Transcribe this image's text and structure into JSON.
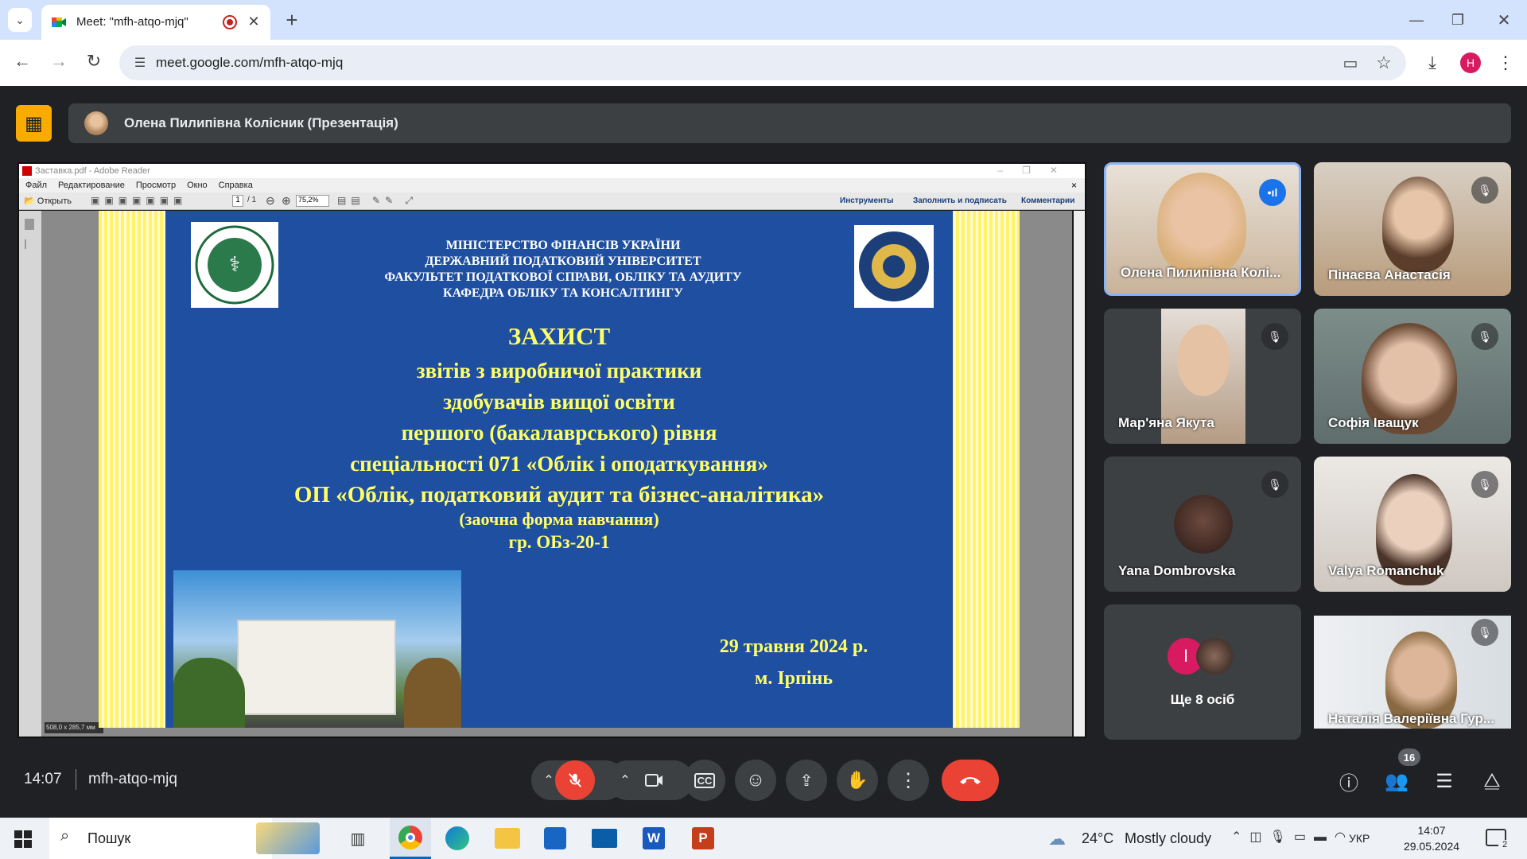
{
  "browser": {
    "tab_title": "Meet: \"mfh-atqo-mjq\"",
    "url": "meet.google.com/mfh-atqo-mjq",
    "profile_initial": "H",
    "window_controls": [
      "minimize",
      "restore",
      "close"
    ]
  },
  "presenter_bar": {
    "label": "Олена Пилипівна Колісник (Презентація)"
  },
  "reader": {
    "title": "Заставка.pdf - Adobe Reader",
    "menu": [
      "Файл",
      "Редактирование",
      "Просмотр",
      "Окно",
      "Справка"
    ],
    "open_label": "Открыть",
    "page_current": "1",
    "page_total": "/ 1",
    "zoom": "75,2%",
    "right_buttons": [
      "Инструменты",
      "Заполнить и подписать",
      "Комментарии"
    ],
    "size_label": "508,0 x 285,7 мм"
  },
  "slide": {
    "header_lines": [
      "МІНІСТЕРСТВО ФІНАНСІВ УКРАЇНИ",
      "ДЕРЖАВНИЙ ПОДАТКОВИЙ УНІВЕРСИТЕТ",
      "ФАКУЛЬТЕТ ПОДАТКОВОЇ СПРАВИ, ОБЛІКУ ТА АУДИТУ",
      "КАФЕДРА ОБЛІКУ ТА КОНСАЛТИНГУ"
    ],
    "title": "ЗАХИСТ",
    "body_lines": [
      "звітів з виробничої практики",
      "здобувачів вищої освіти",
      "першого (бакалаврського) рівня",
      "спеціальності 071 «Облік і оподаткування»",
      "ОП «Облік, податковий аудит та бізнес-аналітика»"
    ],
    "form_line": "(заочна форма навчання)",
    "group_line": "гр. ОБз-20-1",
    "date_line": "29 травня 2024 р.",
    "city_line": "м. Ірпінь",
    "colors": {
      "background": "#1e4fa3",
      "text": "#ffff66",
      "stripes": "#fff36b"
    }
  },
  "participants": [
    {
      "name": "Олена Пилипівна Колі...",
      "muted": false,
      "speaking": true
    },
    {
      "name": "Пінаєва Анастасія",
      "muted": true
    },
    {
      "name": "Мар'яна Якута",
      "muted": true
    },
    {
      "name": "Софія Іващук",
      "muted": true
    },
    {
      "name": "Yana Dombrovska",
      "muted": true
    },
    {
      "name": "Valya Romanchuk",
      "muted": true
    },
    {
      "name": "Ще 8 осіб",
      "avatar_letter": "I"
    },
    {
      "name": "Наталія Валеріївна Гур...",
      "muted": true
    }
  ],
  "meeting": {
    "time": "14:07",
    "code": "mfh-atqo-mjq",
    "people_count": "16"
  },
  "taskbar": {
    "search": "Пошук",
    "weather_temp": "24°C",
    "weather_text": "Mostly cloudy",
    "lang": "УКР",
    "time": "14:07",
    "date": "29.05.2024",
    "notif_count": "2"
  }
}
